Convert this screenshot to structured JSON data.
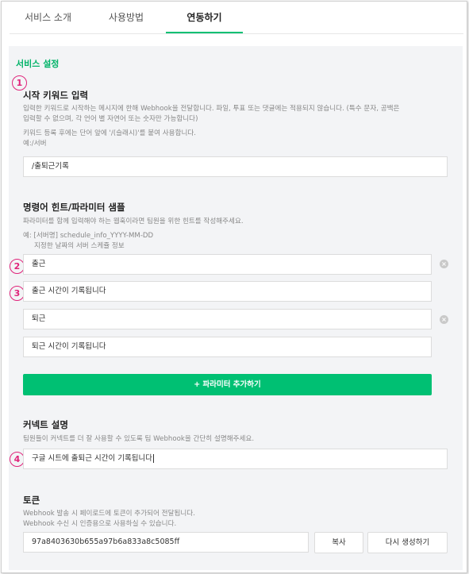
{
  "tabs": [
    {
      "label": "서비스 소개"
    },
    {
      "label": "사용방법"
    },
    {
      "label": "연동하기"
    }
  ],
  "service_settings": {
    "title": "서비스 설정",
    "start_keyword": {
      "marker": "1",
      "heading": "시작 키워드 입력",
      "desc1_line1": "입력한 키워드로 시작하는 메시지에 한해 Webhook을 전달합니다. 파일, 투표 또는 댓글에는 적용되지 않습니다. (특수 문자, 공백은",
      "desc1_line2": "입력할 수 없으며, 각 언어 별 자연어 또는 숫자만 가능합니다)",
      "desc2_line1": "키워드 등록 후에는 단어 앞에 '/(슬래시)'를 붙여 사용합니다.",
      "desc2_line2": "예:/서버",
      "value": "/출퇴근기록"
    },
    "command_hint": {
      "heading": "명령어 힌트/파라미터 샘플",
      "desc1": "파라미터를 함께 입력해야 하는 웹훅이라면 팀원을 위한 힌트를 작성해주세요.",
      "example_line1": "예: [서버명] schedule_info_YYYY-MM-DD",
      "example_line2": "지정한 날짜의 서버 스케쥴 정보",
      "params": [
        {
          "marker": "2",
          "value": "출근",
          "clear": "×"
        },
        {
          "marker": "3",
          "value": "출근 시간이 기록됩니다"
        },
        {
          "value": "퇴근",
          "clear": "×"
        },
        {
          "value": "퇴근 시간이 기록됩니다"
        }
      ],
      "add_button": "+ 파라미터 추가하기"
    },
    "connect_desc": {
      "heading": "커넥트 설명",
      "desc": "팀원들이 커넥트를 더 잘 사용할 수 있도록 팀 Webhook을 간단히 설명해주세요.",
      "marker": "4",
      "value": "구글 시트에 출퇴근 시간이 기록됩니다"
    },
    "token": {
      "heading": "토큰",
      "desc_line1": "Webhook 발송 시 페이로드에 토큰이 추가되어 전달됩니다.",
      "desc_line2": "Webhook 수신 시 인증용으로 사용하실 수 있습니다.",
      "value": "97a8403630b655a97b6a833a8c5085ff",
      "copy_button": "복사",
      "regenerate_button": "다시 생성하기"
    }
  },
  "colors": {
    "accent": "#00c073",
    "marker": "#e0237a",
    "panel_bg": "#f3f4f6"
  }
}
